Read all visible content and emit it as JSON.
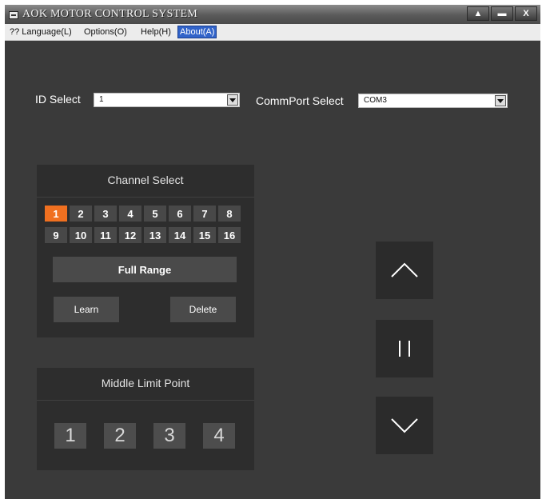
{
  "window": {
    "title": "AOK MOTOR CONTROL SYSTEM",
    "controls": {
      "up": "▲",
      "minimize": "▬",
      "close": "X"
    }
  },
  "menu": [
    {
      "label": "?? Language(L)",
      "active": false
    },
    {
      "label": "Options(O)",
      "active": false
    },
    {
      "label": "Help(H)",
      "active": false
    },
    {
      "label": "About(A)",
      "active": true
    }
  ],
  "id_select": {
    "label": "ID Select",
    "value": "1"
  },
  "commport_select": {
    "label": "CommPort Select",
    "value": "COM3"
  },
  "channel_panel": {
    "title": "Channel Select",
    "channels": [
      "1",
      "2",
      "3",
      "4",
      "5",
      "6",
      "7",
      "8",
      "9",
      "10",
      "11",
      "12",
      "13",
      "14",
      "15",
      "16"
    ],
    "selected": "1",
    "full_range_label": "Full Range",
    "learn_label": "Learn",
    "delete_label": "Delete"
  },
  "middle_panel": {
    "title": "Middle Limit Point",
    "points": [
      "1",
      "2",
      "3",
      "4"
    ]
  },
  "controls": {
    "up_icon": "chevron-up-icon",
    "pause_icon": "pause-icon",
    "down_icon": "chevron-down-icon"
  },
  "colors": {
    "accent": "#f07020",
    "background": "#3a3a3a",
    "panel": "#2d2d2d",
    "menu_active": "#3163c9"
  }
}
